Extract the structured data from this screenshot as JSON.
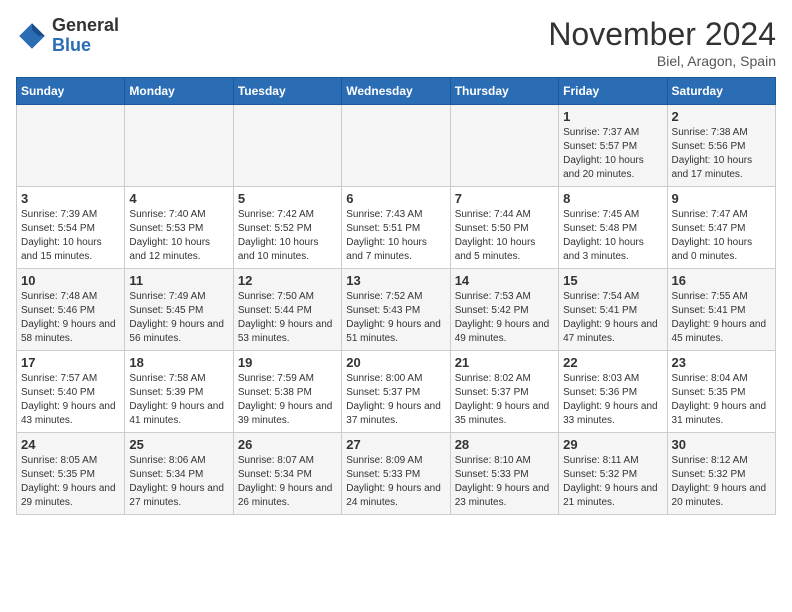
{
  "header": {
    "logo_general": "General",
    "logo_blue": "Blue",
    "month_title": "November 2024",
    "location": "Biel, Aragon, Spain"
  },
  "days_of_week": [
    "Sunday",
    "Monday",
    "Tuesday",
    "Wednesday",
    "Thursday",
    "Friday",
    "Saturday"
  ],
  "weeks": [
    [
      {
        "day": "",
        "info": ""
      },
      {
        "day": "",
        "info": ""
      },
      {
        "day": "",
        "info": ""
      },
      {
        "day": "",
        "info": ""
      },
      {
        "day": "",
        "info": ""
      },
      {
        "day": "1",
        "info": "Sunrise: 7:37 AM\nSunset: 5:57 PM\nDaylight: 10 hours and 20 minutes."
      },
      {
        "day": "2",
        "info": "Sunrise: 7:38 AM\nSunset: 5:56 PM\nDaylight: 10 hours and 17 minutes."
      }
    ],
    [
      {
        "day": "3",
        "info": "Sunrise: 7:39 AM\nSunset: 5:54 PM\nDaylight: 10 hours and 15 minutes."
      },
      {
        "day": "4",
        "info": "Sunrise: 7:40 AM\nSunset: 5:53 PM\nDaylight: 10 hours and 12 minutes."
      },
      {
        "day": "5",
        "info": "Sunrise: 7:42 AM\nSunset: 5:52 PM\nDaylight: 10 hours and 10 minutes."
      },
      {
        "day": "6",
        "info": "Sunrise: 7:43 AM\nSunset: 5:51 PM\nDaylight: 10 hours and 7 minutes."
      },
      {
        "day": "7",
        "info": "Sunrise: 7:44 AM\nSunset: 5:50 PM\nDaylight: 10 hours and 5 minutes."
      },
      {
        "day": "8",
        "info": "Sunrise: 7:45 AM\nSunset: 5:48 PM\nDaylight: 10 hours and 3 minutes."
      },
      {
        "day": "9",
        "info": "Sunrise: 7:47 AM\nSunset: 5:47 PM\nDaylight: 10 hours and 0 minutes."
      }
    ],
    [
      {
        "day": "10",
        "info": "Sunrise: 7:48 AM\nSunset: 5:46 PM\nDaylight: 9 hours and 58 minutes."
      },
      {
        "day": "11",
        "info": "Sunrise: 7:49 AM\nSunset: 5:45 PM\nDaylight: 9 hours and 56 minutes."
      },
      {
        "day": "12",
        "info": "Sunrise: 7:50 AM\nSunset: 5:44 PM\nDaylight: 9 hours and 53 minutes."
      },
      {
        "day": "13",
        "info": "Sunrise: 7:52 AM\nSunset: 5:43 PM\nDaylight: 9 hours and 51 minutes."
      },
      {
        "day": "14",
        "info": "Sunrise: 7:53 AM\nSunset: 5:42 PM\nDaylight: 9 hours and 49 minutes."
      },
      {
        "day": "15",
        "info": "Sunrise: 7:54 AM\nSunset: 5:41 PM\nDaylight: 9 hours and 47 minutes."
      },
      {
        "day": "16",
        "info": "Sunrise: 7:55 AM\nSunset: 5:41 PM\nDaylight: 9 hours and 45 minutes."
      }
    ],
    [
      {
        "day": "17",
        "info": "Sunrise: 7:57 AM\nSunset: 5:40 PM\nDaylight: 9 hours and 43 minutes."
      },
      {
        "day": "18",
        "info": "Sunrise: 7:58 AM\nSunset: 5:39 PM\nDaylight: 9 hours and 41 minutes."
      },
      {
        "day": "19",
        "info": "Sunrise: 7:59 AM\nSunset: 5:38 PM\nDaylight: 9 hours and 39 minutes."
      },
      {
        "day": "20",
        "info": "Sunrise: 8:00 AM\nSunset: 5:37 PM\nDaylight: 9 hours and 37 minutes."
      },
      {
        "day": "21",
        "info": "Sunrise: 8:02 AM\nSunset: 5:37 PM\nDaylight: 9 hours and 35 minutes."
      },
      {
        "day": "22",
        "info": "Sunrise: 8:03 AM\nSunset: 5:36 PM\nDaylight: 9 hours and 33 minutes."
      },
      {
        "day": "23",
        "info": "Sunrise: 8:04 AM\nSunset: 5:35 PM\nDaylight: 9 hours and 31 minutes."
      }
    ],
    [
      {
        "day": "24",
        "info": "Sunrise: 8:05 AM\nSunset: 5:35 PM\nDaylight: 9 hours and 29 minutes."
      },
      {
        "day": "25",
        "info": "Sunrise: 8:06 AM\nSunset: 5:34 PM\nDaylight: 9 hours and 27 minutes."
      },
      {
        "day": "26",
        "info": "Sunrise: 8:07 AM\nSunset: 5:34 PM\nDaylight: 9 hours and 26 minutes."
      },
      {
        "day": "27",
        "info": "Sunrise: 8:09 AM\nSunset: 5:33 PM\nDaylight: 9 hours and 24 minutes."
      },
      {
        "day": "28",
        "info": "Sunrise: 8:10 AM\nSunset: 5:33 PM\nDaylight: 9 hours and 23 minutes."
      },
      {
        "day": "29",
        "info": "Sunrise: 8:11 AM\nSunset: 5:32 PM\nDaylight: 9 hours and 21 minutes."
      },
      {
        "day": "30",
        "info": "Sunrise: 8:12 AM\nSunset: 5:32 PM\nDaylight: 9 hours and 20 minutes."
      }
    ]
  ]
}
